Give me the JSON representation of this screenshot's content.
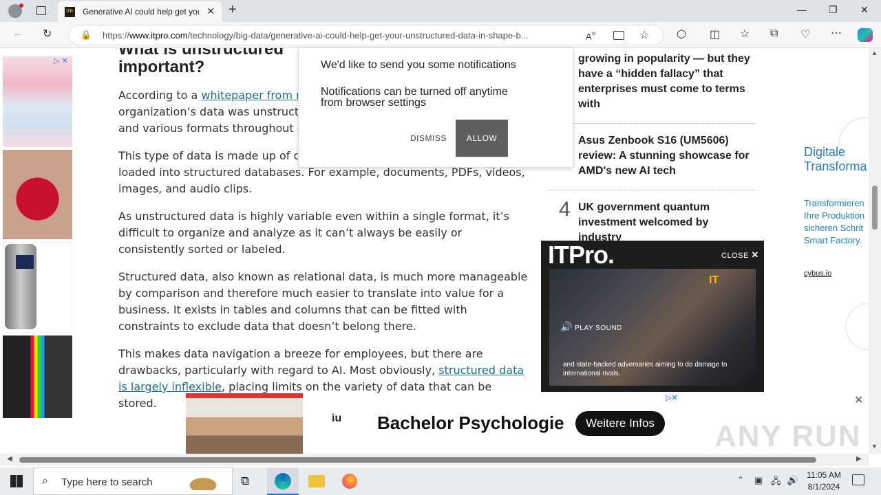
{
  "browser": {
    "tab_title": "Generative AI could help get you",
    "tab_favicon": "ITP.",
    "url_prefix": "https://",
    "url_domain": "www.itpro.com",
    "url_path": "/technology/big-data/generative-ai-could-help-get-your-unstructured-data-in-shape-b..."
  },
  "article": {
    "heading_line1": "What is unstructured",
    "heading_line2": "important?",
    "p1_before": "According to a ",
    "p1_link": "whitepaper from re",
    "p1_line2": "organization’s data was unstructur",
    "p1_line3": "and various formats throughout co",
    "p2": "This type of data is made up of con",
    "p2_line2": "loaded into structured databases. For example, documents, PDFs, videos,",
    "p2_line3": "images, and audio clips.",
    "p3": "As unstructured data is highly variable even within a single format, it’s difficult to organize and analyze as it can’t always be easily or consistently sorted or labeled.",
    "p4": "Structured data, also known as relational data, is much more manageable by comparison and therefore much easier to translate into value for a business. It exists in tables and columns that can be fitted with constraints to exclude data that doesn’t belong there.",
    "p5_before": "This makes data navigation a breeze for employees, but there are drawbacks, particularly with regard to AI. Most obviously, ",
    "p5_link": "structured data is largely inflexible",
    "p5_after": ", placing limits on the variety of data that can be stored."
  },
  "notification": {
    "line1": "We'd like to send you some notifications",
    "line2": "Notifications can be turned off anytime from browser settings",
    "dismiss": "DISMISS",
    "allow": "ALLOW"
  },
  "sidebar": {
    "item1_text": "growing in popularity — but they have a “hidden fallacy” that enterprises must come to terms with",
    "item2_text": "Asus Zenbook S16 (UM5606) review: A stunning showcase for AMD's new AI tech",
    "item3_number": "4",
    "item3_text": "UK government quantum investment welcomed by industry"
  },
  "right_ad": {
    "title": "Digitale Transforma",
    "body": "Transformieren Ihre Produktion sicheren Schrit Smart Factory.",
    "link": "cybus.io"
  },
  "video": {
    "logo": "ITPro.",
    "close": "CLOSE",
    "play_sound": "PLAY SOUND",
    "caption": "and state-backed adversaries aiming to do damage to international rivals.",
    "watermark": "IT"
  },
  "banner": {
    "brand": "iu",
    "headline": "Bachelor Psychologie",
    "cta": "Weitere Infos"
  },
  "taskbar": {
    "search_placeholder": "Type here to search",
    "time": "11:05 AM",
    "date": "8/1/2024"
  },
  "watermark": "ANY RUN",
  "colors": {
    "link": "#1a6f8f",
    "allow_bg": "#5f5f5f",
    "ad_blue": "#1f7ecb"
  }
}
